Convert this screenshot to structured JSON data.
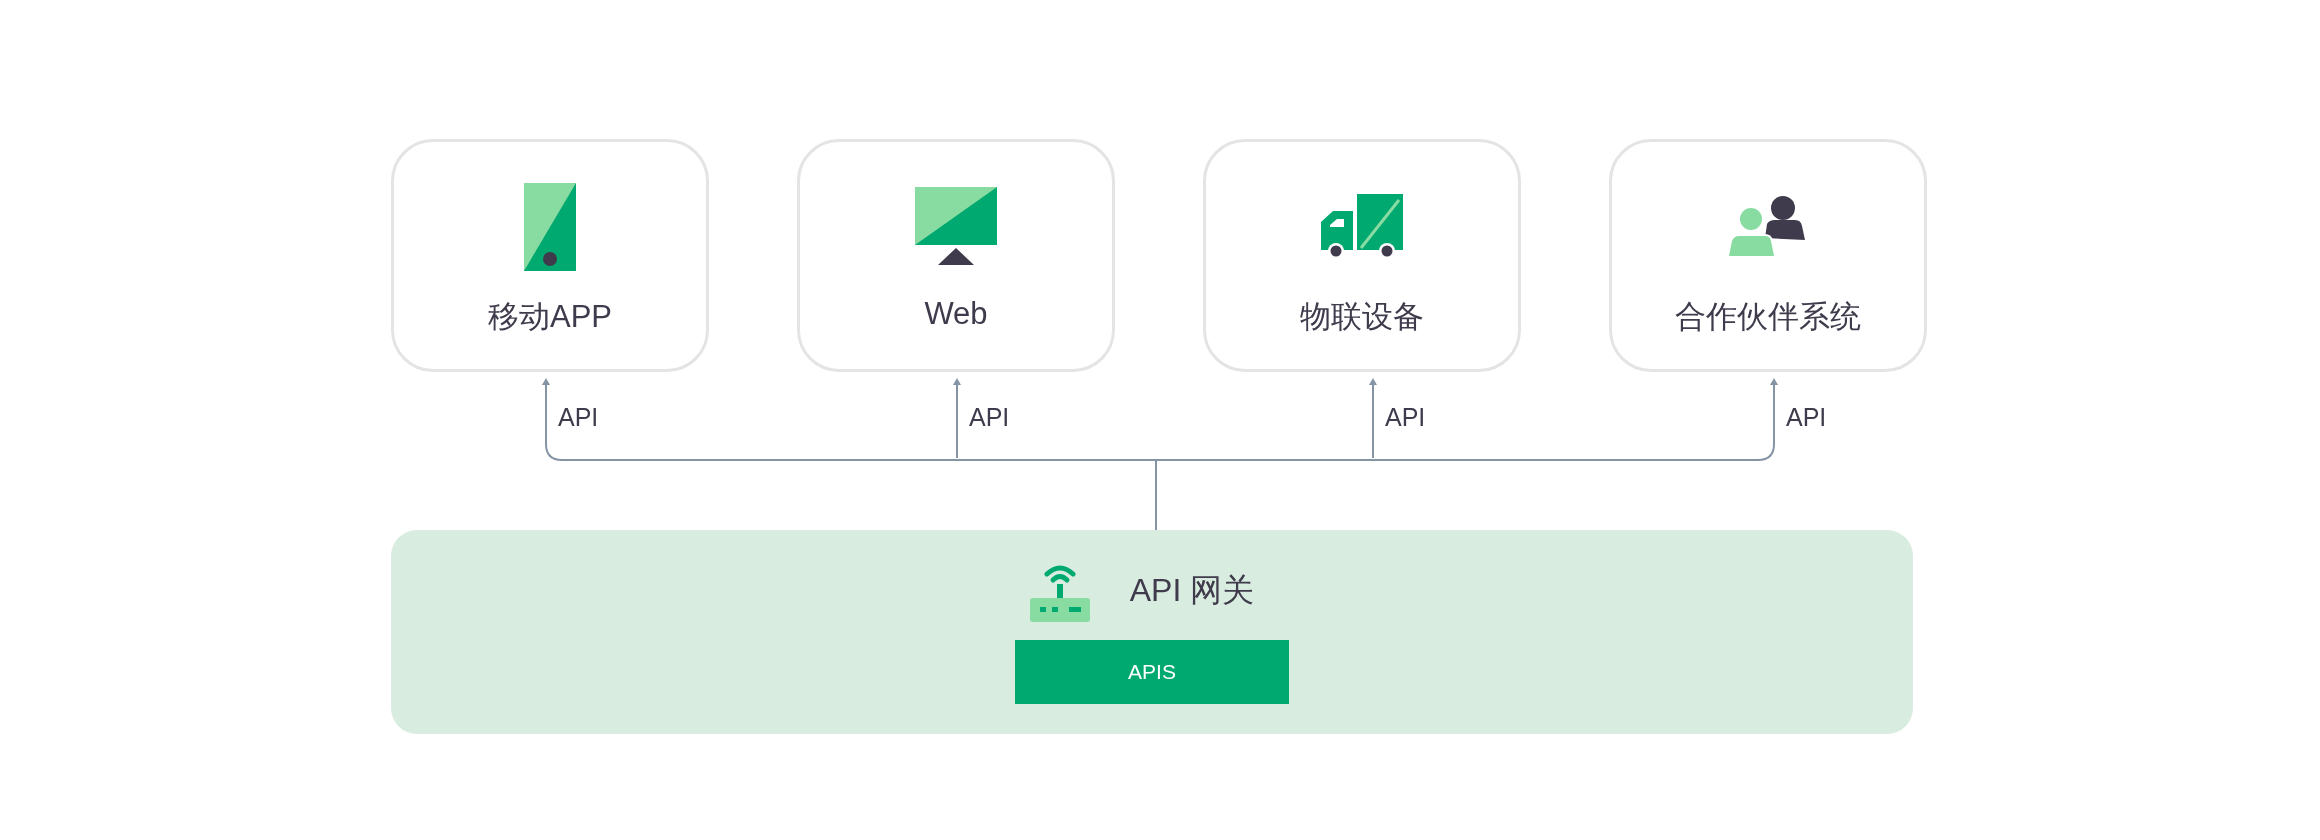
{
  "clients": [
    {
      "label": "移动APP",
      "kind": "phone"
    },
    {
      "label": "Web",
      "kind": "monitor"
    },
    {
      "label": "物联设备",
      "kind": "truck"
    },
    {
      "label": "合作伙伴系统",
      "kind": "people"
    }
  ],
  "connections": [
    {
      "label": "API"
    },
    {
      "label": "API"
    },
    {
      "label": "API"
    },
    {
      "label": "API"
    }
  ],
  "gateway": {
    "title": "API 网关",
    "block": "APIS"
  }
}
